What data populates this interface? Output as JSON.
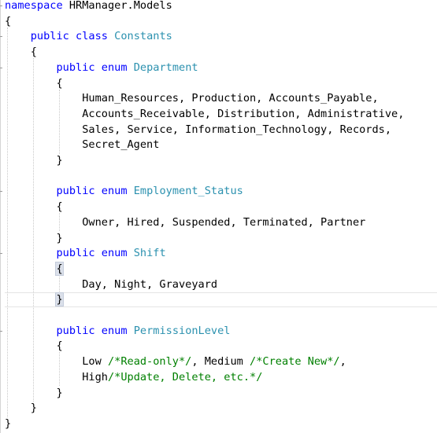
{
  "editor": {
    "lines": [
      [
        {
          "t": "namespace",
          "c": "kw"
        },
        {
          "t": " HRManager.Models",
          "c": "pl"
        }
      ],
      [
        {
          "t": "{",
          "c": "pl"
        }
      ],
      [
        {
          "t": "    ",
          "c": "pl"
        },
        {
          "t": "public",
          "c": "kw"
        },
        {
          "t": " ",
          "c": "pl"
        },
        {
          "t": "class",
          "c": "kw"
        },
        {
          "t": " ",
          "c": "pl"
        },
        {
          "t": "Constants",
          "c": "ty"
        }
      ],
      [
        {
          "t": "    {",
          "c": "pl"
        }
      ],
      [
        {
          "t": "        ",
          "c": "pl"
        },
        {
          "t": "public",
          "c": "kw"
        },
        {
          "t": " ",
          "c": "pl"
        },
        {
          "t": "enum",
          "c": "kw"
        },
        {
          "t": " ",
          "c": "pl"
        },
        {
          "t": "Department",
          "c": "ty"
        }
      ],
      [
        {
          "t": "        {",
          "c": "pl"
        }
      ],
      [
        {
          "t": "            Human_Resources, Production, Accounts_Payable,",
          "c": "pl"
        }
      ],
      [
        {
          "t": "            Accounts_Receivable, Distribution, Administrative,",
          "c": "pl"
        }
      ],
      [
        {
          "t": "            Sales, Service, Information_Technology, Records,",
          "c": "pl"
        }
      ],
      [
        {
          "t": "            Secret_Agent",
          "c": "pl"
        }
      ],
      [
        {
          "t": "        }",
          "c": "pl"
        }
      ],
      [],
      [
        {
          "t": "        ",
          "c": "pl"
        },
        {
          "t": "public",
          "c": "kw"
        },
        {
          "t": " ",
          "c": "pl"
        },
        {
          "t": "enum",
          "c": "kw"
        },
        {
          "t": " ",
          "c": "pl"
        },
        {
          "t": "Employment_Status",
          "c": "ty"
        }
      ],
      [
        {
          "t": "        {",
          "c": "pl"
        }
      ],
      [
        {
          "t": "            Owner, Hired, Suspended, Terminated, Partner",
          "c": "pl"
        }
      ],
      [
        {
          "t": "        }",
          "c": "pl"
        }
      ],
      [
        {
          "t": "        ",
          "c": "pl"
        },
        {
          "t": "public",
          "c": "kw"
        },
        {
          "t": " ",
          "c": "pl"
        },
        {
          "t": "enum",
          "c": "kw"
        },
        {
          "t": " ",
          "c": "pl"
        },
        {
          "t": "Shift",
          "c": "ty"
        }
      ],
      [
        {
          "t": "        ",
          "c": "pl"
        },
        {
          "t": "{",
          "c": "pl",
          "hl": true
        }
      ],
      [
        {
          "t": "            Day, Night, Graveyard",
          "c": "pl"
        }
      ],
      [
        {
          "t": "        ",
          "c": "pl"
        },
        {
          "t": "}",
          "c": "pl",
          "hl": true,
          "caret": true
        }
      ],
      [],
      [
        {
          "t": "        ",
          "c": "pl"
        },
        {
          "t": "public",
          "c": "kw"
        },
        {
          "t": " ",
          "c": "pl"
        },
        {
          "t": "enum",
          "c": "kw"
        },
        {
          "t": " ",
          "c": "pl"
        },
        {
          "t": "PermissionLevel",
          "c": "ty"
        }
      ],
      [
        {
          "t": "        {",
          "c": "pl"
        }
      ],
      [
        {
          "t": "            Low ",
          "c": "pl"
        },
        {
          "t": "/*Read-only*/",
          "c": "cm"
        },
        {
          "t": ", Medium ",
          "c": "pl"
        },
        {
          "t": "/*Create New*/",
          "c": "cm"
        },
        {
          "t": ",",
          "c": "pl"
        }
      ],
      [
        {
          "t": "            High",
          "c": "pl"
        },
        {
          "t": "/*Update, Delete, etc.*/",
          "c": "cm"
        }
      ],
      [
        {
          "t": "        }",
          "c": "pl"
        }
      ],
      [
        {
          "t": "    }",
          "c": "pl"
        }
      ],
      [
        {
          "t": "}",
          "c": "pl"
        }
      ]
    ]
  },
  "colors": {
    "keyword": "#0000ff",
    "type": "#2b91af",
    "comment": "#008000",
    "plain": "#000000"
  }
}
